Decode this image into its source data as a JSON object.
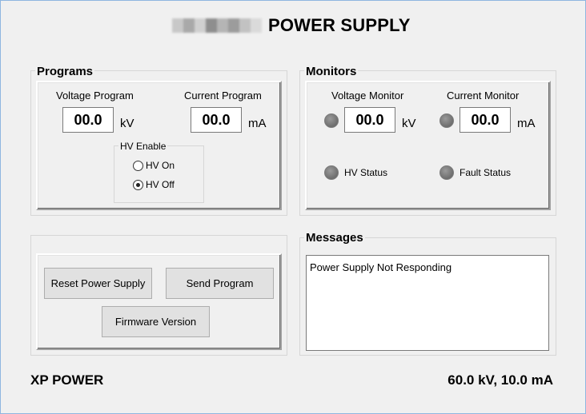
{
  "header": {
    "title": "POWER SUPPLY"
  },
  "programs": {
    "group_label": "Programs",
    "voltage_label": "Voltage Program",
    "voltage_value": "00.0",
    "voltage_unit": "kV",
    "current_label": "Current Program",
    "current_value": "00.0",
    "current_unit": "mA",
    "hv_enable": {
      "label": "HV Enable",
      "options": [
        {
          "label": "HV On",
          "checked": false
        },
        {
          "label": "HV Off",
          "checked": true
        }
      ]
    }
  },
  "monitors": {
    "group_label": "Monitors",
    "voltage_label": "Voltage Monitor",
    "voltage_value": "00.0",
    "voltage_unit": "kV",
    "current_label": "Current Monitor",
    "current_value": "00.0",
    "current_unit": "mA",
    "hv_status_label": "HV Status",
    "fault_status_label": "Fault Status"
  },
  "actions": {
    "reset_label": "Reset Power Supply",
    "send_label": "Send Program",
    "firmware_label": "Firmware Version"
  },
  "messages": {
    "group_label": "Messages",
    "text": "Power Supply Not Responding"
  },
  "footer": {
    "brand": "XP POWER",
    "rating": "60.0 kV, 10.0 mA"
  },
  "colors": {
    "led_off": "#7a7a7a",
    "window_bg": "#f0f0f0",
    "window_border": "#8fb6e0"
  }
}
